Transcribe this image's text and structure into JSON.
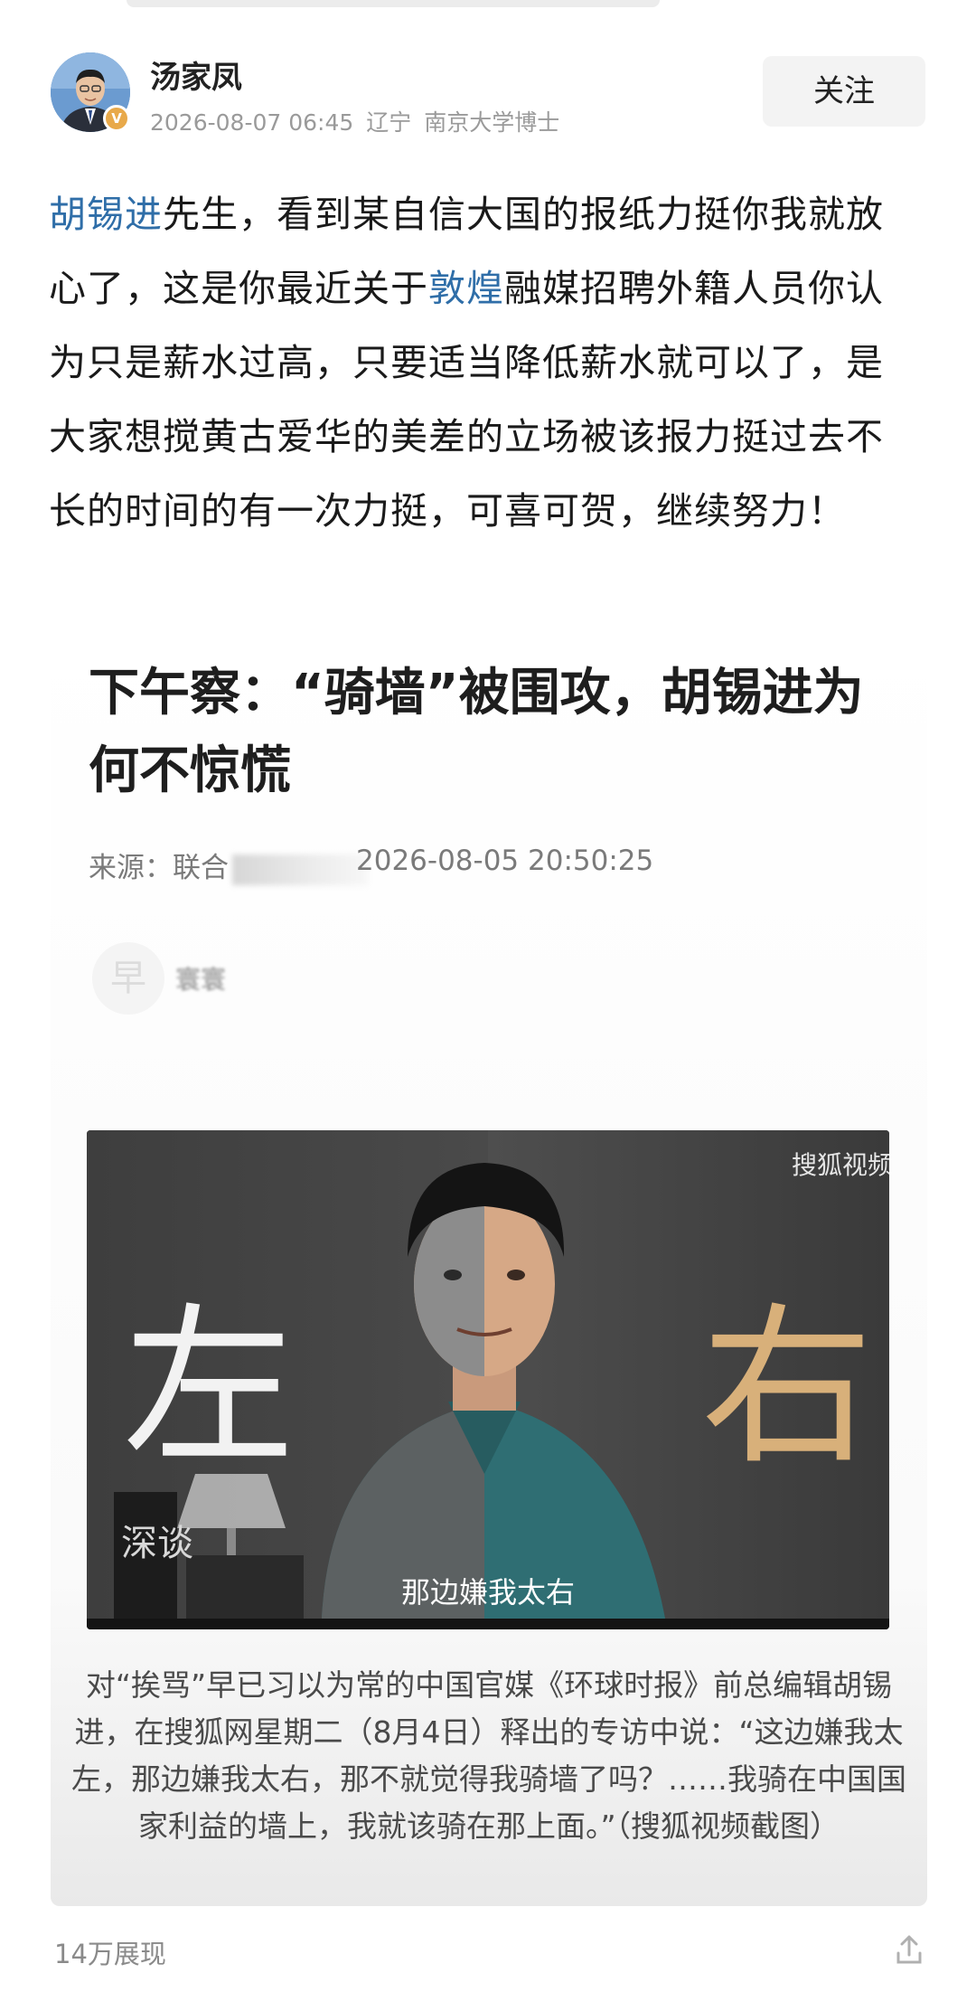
{
  "author": {
    "name": "汤家凤",
    "timestamp": "2026-08-07 06:45",
    "location": "辽宁",
    "title": "南京大学博士",
    "follow_label": "关注",
    "verified_icon": "verified-badge-icon"
  },
  "post": {
    "segments": [
      {
        "text": "胡锡进",
        "link": true
      },
      {
        "text": "先生，看到某自信大国的报纸力挺你我就放心了，这是你最近关于",
        "link": false
      },
      {
        "text": "敦煌",
        "link": true
      },
      {
        "text": "融媒招聘外籍人员你认为只是薪水过高，只要适当降低薪水就可以了，是大家想搅黄古爱华的美差的立场被该报力挺过去不长的时间的有一次力挺，可喜可贺，继续努力！",
        "link": false
      }
    ]
  },
  "embedded_article": {
    "title": "下午察：“骑墙”被围攻，胡锡进为何不惊慌",
    "source_label": "来源：",
    "source_visible": "联合",
    "date": "2026-08-05 20:50:25",
    "publisher_logo_char": "早",
    "publisher_name_visible": "寰寰",
    "video": {
      "watermark": "搜狐视频",
      "left_char": "左",
      "right_char": "右",
      "subtitle": "那边嫌我太右",
      "book_label": "深谈"
    },
    "caption": "对“挨骂”早已习以为常的中国官媒《环球时报》前总编辑胡锡进，在搜狐网星期二（8月4日）释出的专访中说：“这边嫌我太左，那边嫌我太右，那不就觉得我骑墙了吗？……我骑在中国国家利益的墙上，我就该骑在那上面。”（搜狐视频截图）"
  },
  "footer": {
    "views": "14万展现",
    "share_icon": "share-icon"
  },
  "colors": {
    "link": "#2f6ea8",
    "meta": "#9a9a9a",
    "badge": "#e8a94a"
  }
}
